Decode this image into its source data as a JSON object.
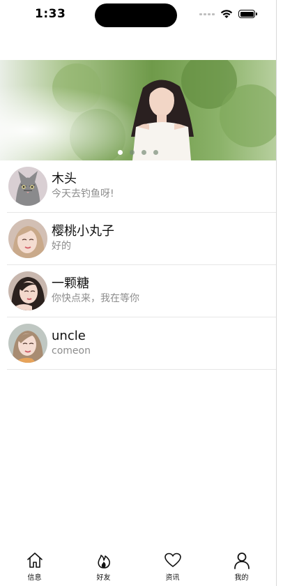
{
  "status_bar": {
    "time": "1:33"
  },
  "banner": {
    "slide_count": 4,
    "active_slide": 0
  },
  "chats": [
    {
      "name": "木头",
      "message": "今天去钓鱼呀!"
    },
    {
      "name": "樱桃小丸子",
      "message": "好的"
    },
    {
      "name": "一颗糖",
      "message": "你快点来，我在等你"
    },
    {
      "name": "uncle",
      "message": "comeon"
    }
  ],
  "tabs": [
    {
      "label": "信息",
      "icon": "home-icon"
    },
    {
      "label": "好友",
      "icon": "flame-icon"
    },
    {
      "label": "资讯",
      "icon": "heart-icon"
    },
    {
      "label": "我的",
      "icon": "person-icon"
    }
  ]
}
